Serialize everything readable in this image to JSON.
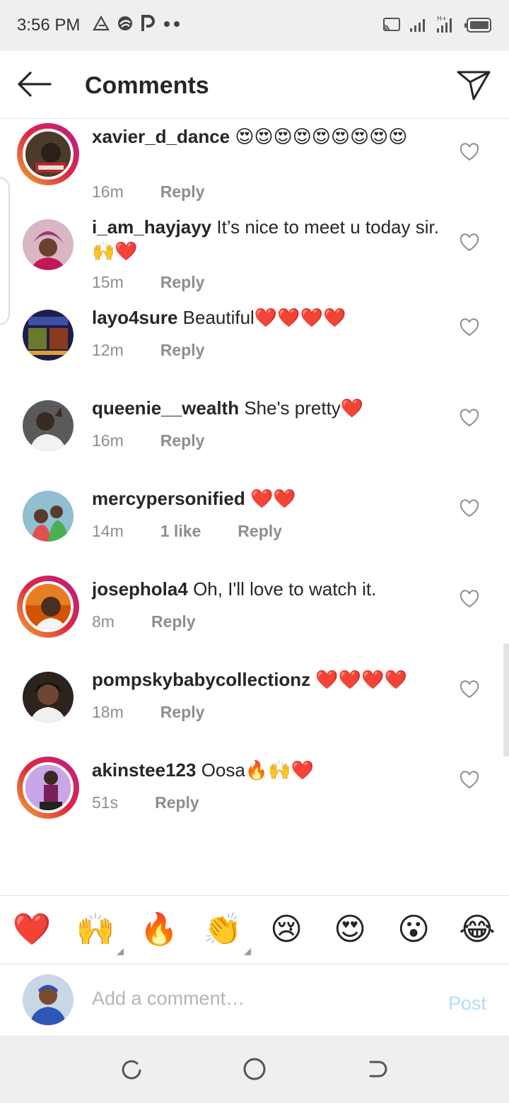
{
  "status_bar": {
    "time": "3:56 PM",
    "left_icons": [
      "triangle-icon",
      "swirl-icon",
      "p-icon",
      "dots-icon"
    ],
    "right_icons": [
      "cast-icon",
      "signal-icon",
      "signal-ht-icon",
      "battery-icon"
    ]
  },
  "header": {
    "title": "Comments",
    "back_icon": "arrow-left-icon",
    "share_icon": "send-icon"
  },
  "comments": [
    {
      "username": "xavier_d_dance",
      "text": "😍😍😍😍😍😍😍😍😍",
      "time": "16m",
      "likes": "",
      "reply": "Reply",
      "story_ring": true
    },
    {
      "username": "i_am_hayjayy",
      "text": "It’s nice to meet u today sir.🙌❤️",
      "time": "15m",
      "likes": "",
      "reply": "Reply",
      "story_ring": false
    },
    {
      "username": "layo4sure",
      "text": "Beautiful❤️❤️❤️❤️",
      "time": "12m",
      "likes": "",
      "reply": "Reply",
      "story_ring": false
    },
    {
      "username": "queenie__wealth",
      "text": "She's pretty❤️",
      "time": "16m",
      "likes": "",
      "reply": "Reply",
      "story_ring": false
    },
    {
      "username": "mercypersonified",
      "text": "❤️❤️",
      "time": "14m",
      "likes": "1 like",
      "reply": "Reply",
      "story_ring": false
    },
    {
      "username": "josephola4",
      "text": "Oh, I'll love to watch it.",
      "time": "8m",
      "likes": "",
      "reply": "Reply",
      "story_ring": true
    },
    {
      "username": "pompskybabycollectionz",
      "text": "❤️❤️❤️❤️",
      "time": "18m",
      "likes": "",
      "reply": "Reply",
      "story_ring": false
    },
    {
      "username": "akinstee123",
      "text": "Oosa🔥🙌❤️",
      "time": "51s",
      "likes": "",
      "reply": "Reply",
      "story_ring": true
    }
  ],
  "emoji_bar": [
    "❤️",
    "🙌",
    "🔥",
    "👏",
    "😢",
    "😍",
    "😮",
    "😂"
  ],
  "compose": {
    "placeholder": "Add a comment…",
    "post_label": "Post"
  },
  "nav_bar": [
    "recents-icon",
    "home-icon",
    "back-icon"
  ],
  "colors": {
    "accent_post_disabled": "#b3dbff",
    "secondary_text": "#8e8e8e",
    "heart_red": "#ed4956"
  }
}
